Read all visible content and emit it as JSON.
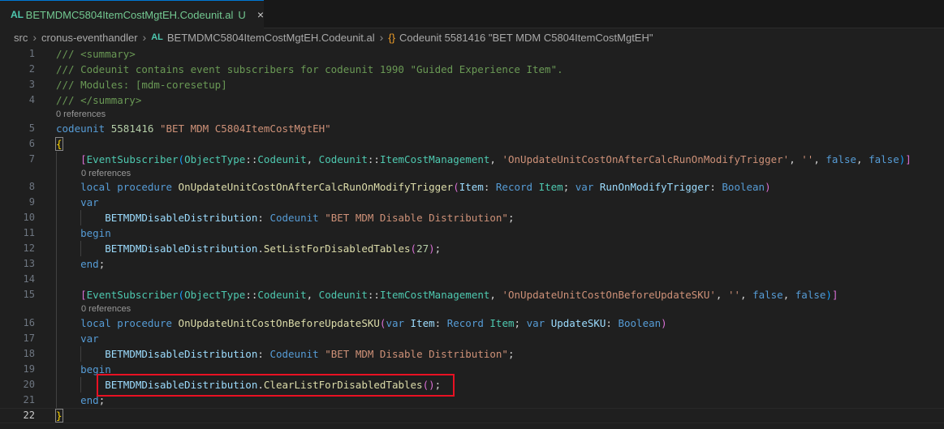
{
  "tab": {
    "lang_icon": "AL",
    "title": "BETMDMC5804ItemCostMgtEH.Codeunit.al",
    "modified": "U",
    "close": "×"
  },
  "breadcrumb": {
    "items": [
      "src",
      "cronus-eventhandler",
      "BETMDMC5804ItemCostMgtEH.Codeunit.al",
      "Codeunit 5581416 \"BET MDM C5804ItemCostMgtEH\""
    ],
    "separator": "›",
    "file_icon": "AL",
    "symbol_icon": "{}"
  },
  "editor": {
    "line_numbers": [
      "1",
      "2",
      "3",
      "4",
      "5",
      "6",
      "7",
      "8",
      "9",
      "10",
      "11",
      "12",
      "13",
      "14",
      "15",
      "16",
      "17",
      "18",
      "19",
      "20",
      "21",
      "22"
    ],
    "code_lens": {
      "references": "0 references"
    },
    "code": {
      "l1": "/// <summary>",
      "l2": "/// Codeunit contains event subscribers for codeunit 1990 \"Guided Experience Item\".",
      "l3": "/// Modules: [mdm-coresetup]",
      "l4": "/// </summary>",
      "kw_codeunit": "codeunit",
      "codeunit_id": "5581416",
      "codeunit_name": "\"BET MDM C5804ItemCostMgtEH\"",
      "open_brace": "{",
      "close_brace": "}",
      "attr_name": "EventSubscriber",
      "object_type": "ObjectType",
      "codeunit_word": "Codeunit",
      "item_cost_mgmt": "ItemCostManagement",
      "event1": "'OnUpdateUnitCostOnAfterCalcRunOnModifyTrigger'",
      "event2": "'OnUpdateUnitCostOnBeforeUpdateSKU'",
      "empty_str": "''",
      "false_kw": "false",
      "local_kw": "local",
      "procedure_kw": "procedure",
      "proc1": "OnUpdateUnitCostOnAfterCalcRunOnModifyTrigger",
      "proc2": "OnUpdateUnitCostOnBeforeUpdateSKU",
      "item_param": "Item",
      "record_kw": "Record",
      "item_type": "Item",
      "var_kw": "var",
      "run_on_modify": "RunOnModifyTrigger",
      "update_sku": "UpdateSKU",
      "boolean_kw": "Boolean",
      "dist_var": "BETMDMDisableDistribution",
      "dist_type": "\"BET MDM Disable Distribution\"",
      "begin_kw": "begin",
      "end_kw": "end",
      "set_list": "SetListForDisabledTables",
      "set_arg": "27",
      "clear_list": "ClearListForDisabledTables"
    }
  },
  "colors": {
    "background": "#1f1f1f",
    "highlight_box": "#e81123",
    "active_tab_text": "#73c991"
  }
}
